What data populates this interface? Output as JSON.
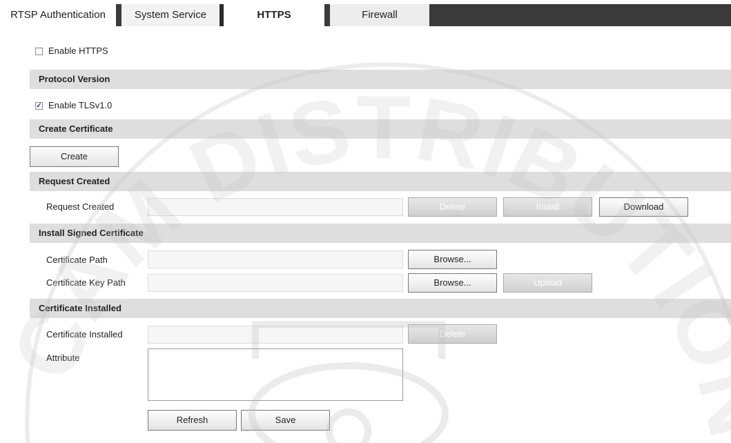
{
  "tabs": [
    {
      "label": "RTSP Authentication"
    },
    {
      "label": "System Service"
    },
    {
      "label": "HTTPS",
      "active": true
    },
    {
      "label": "Firewall"
    }
  ],
  "enable_https": {
    "label": "Enable HTTPS",
    "checked": false
  },
  "sections": {
    "protocol_version": "Protocol Version",
    "create_certificate": "Create Certificate",
    "request_created": "Request Created",
    "install_signed": "Install Signed Certificate",
    "certificate_installed": "Certificate Installed"
  },
  "enable_tls": {
    "label": "Enable TLSv1.0",
    "checked": true
  },
  "create_button": "Create",
  "request_row": {
    "label": "Request Created",
    "value": "",
    "delete": "Delete",
    "install": "Install",
    "download": "Download"
  },
  "cert_path": {
    "label": "Certificate Path",
    "value": "",
    "browse": "Browse..."
  },
  "cert_key_path": {
    "label": "Certificate Key Path",
    "value": "",
    "browse": "Browse...",
    "upload": "Upload"
  },
  "installed_row": {
    "label": "Certificate Installed",
    "value": "",
    "delete": "Delete"
  },
  "attribute": {
    "label": "Attribute",
    "value": ""
  },
  "footer": {
    "refresh": "Refresh",
    "save": "Save"
  },
  "watermark": "CAM DISTRIBUTION",
  "colors": {
    "tab_bar_dark": "#3a3a3a",
    "section_bg": "#dedede",
    "checkbox_tick": "#1a3ca8"
  }
}
